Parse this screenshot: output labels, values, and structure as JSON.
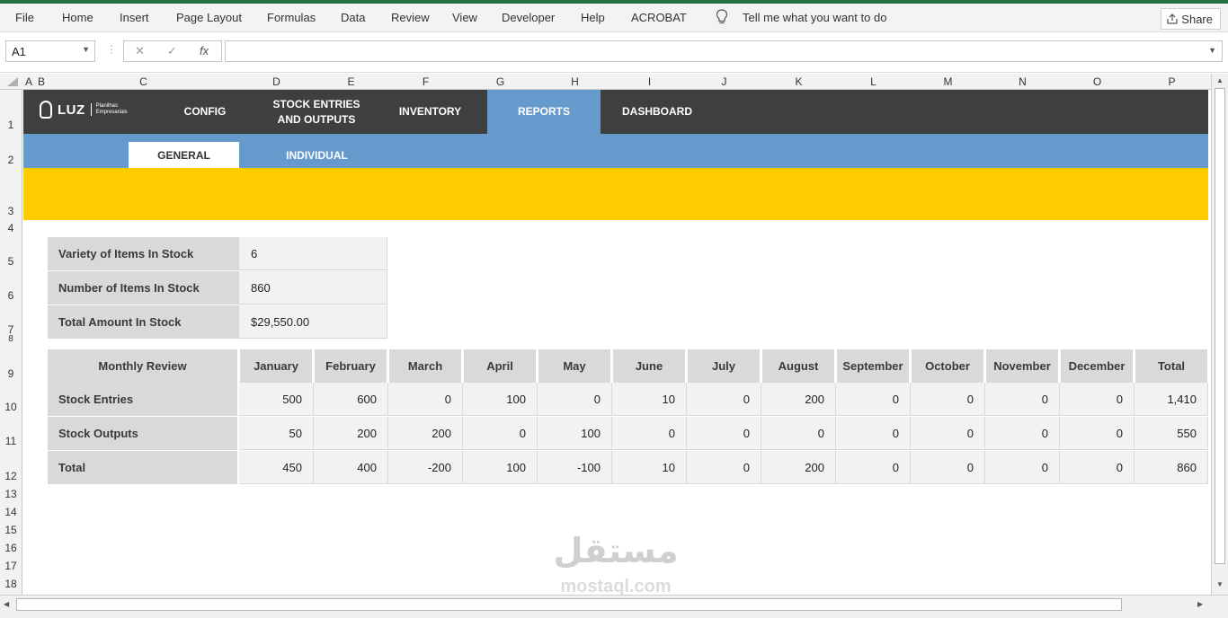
{
  "menu": {
    "items": [
      "File",
      "Home",
      "Insert",
      "Page Layout",
      "Formulas",
      "Data",
      "Review",
      "View",
      "Developer",
      "Help",
      "ACROBAT"
    ],
    "tell_me": "Tell me what you want to do",
    "share": "Share"
  },
  "formula_bar": {
    "name_box": "A1",
    "cancel": "✕",
    "enter": "✓",
    "fx": "fx",
    "formula": ""
  },
  "columns": [
    "A",
    "B",
    "C",
    "D",
    "E",
    "F",
    "G",
    "H",
    "I",
    "J",
    "K",
    "L",
    "M",
    "N",
    "O",
    "P"
  ],
  "rows": [
    "1",
    "2",
    "3",
    "4",
    "5",
    "6",
    "7",
    "8",
    "9",
    "10",
    "11",
    "12",
    "13",
    "14",
    "15",
    "16",
    "17",
    "18"
  ],
  "nav": {
    "logo": "LUZ",
    "logo_sub_1": "Planilhas",
    "logo_sub_2": "Empresariais",
    "config": "CONFIG",
    "stock_entries_1": "STOCK ENTRIES",
    "stock_entries_2": "AND OUTPUTS",
    "inventory": "INVENTORY",
    "reports": "REPORTS",
    "dashboard": "DASHBOARD"
  },
  "subnav": {
    "general": "GENERAL",
    "individual": "INDIVIDUAL"
  },
  "summary": [
    {
      "label": "Variety of Items In Stock",
      "value": "6"
    },
    {
      "label": "Number of Items In Stock",
      "value": "860"
    },
    {
      "label": "Total Amount In Stock",
      "value": "$29,550.00"
    }
  ],
  "monthly_review": {
    "title": "Monthly Review",
    "columns": [
      "January",
      "February",
      "March",
      "April",
      "May",
      "June",
      "July",
      "August",
      "September",
      "October",
      "November",
      "December",
      "Total"
    ],
    "rows": [
      {
        "label": "Stock Entries",
        "values": [
          "500",
          "600",
          "0",
          "100",
          "0",
          "10",
          "0",
          "200",
          "0",
          "0",
          "0",
          "0",
          "1,410"
        ]
      },
      {
        "label": "Stock Outputs",
        "values": [
          "50",
          "200",
          "200",
          "0",
          "100",
          "0",
          "0",
          "0",
          "0",
          "0",
          "0",
          "0",
          "550"
        ]
      },
      {
        "label": "Total",
        "values": [
          "450",
          "400",
          "-200",
          "100",
          "-100",
          "10",
          "0",
          "200",
          "0",
          "0",
          "0",
          "0",
          "860"
        ]
      }
    ]
  },
  "watermark": {
    "arabic": "مستقل",
    "latin": "mostaql.com"
  }
}
